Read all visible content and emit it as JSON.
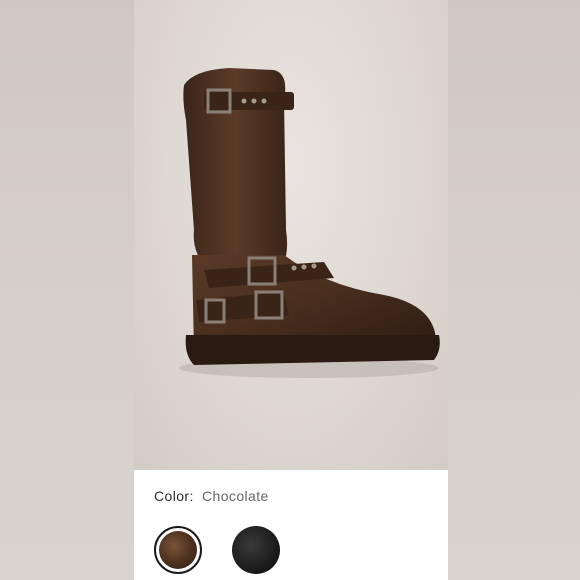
{
  "product": {
    "image_alt": "Chocolate leather moto boot with buckle straps"
  },
  "color_selector": {
    "label": "Color:",
    "value": "Chocolate",
    "swatches": [
      {
        "name": "Chocolate",
        "selected": true,
        "color": "#4f3320"
      },
      {
        "name": "Black",
        "selected": false,
        "color": "#1c1c1c"
      }
    ]
  }
}
